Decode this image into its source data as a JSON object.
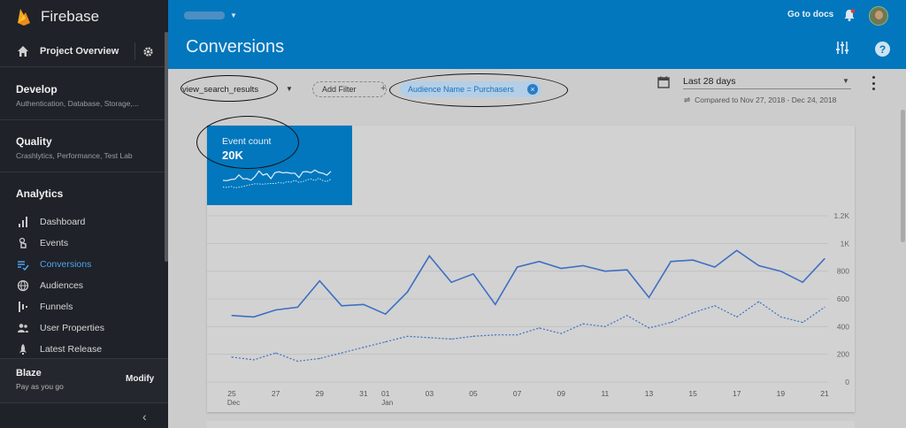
{
  "app": {
    "title": "Firebase"
  },
  "sidebar": {
    "project_overview": "Project Overview",
    "groups": [
      {
        "title": "Develop",
        "subtitle": "Authentication, Database, Storage,..."
      },
      {
        "title": "Quality",
        "subtitle": "Crashlytics, Performance, Test Lab"
      }
    ],
    "analytics_title": "Analytics",
    "items": [
      {
        "label": "Dashboard",
        "icon": "bar-chart-icon",
        "active": false
      },
      {
        "label": "Events",
        "icon": "touch-icon",
        "active": false
      },
      {
        "label": "Conversions",
        "icon": "conversions-icon",
        "active": true
      },
      {
        "label": "Audiences",
        "icon": "globe-icon",
        "active": false
      },
      {
        "label": "Funnels",
        "icon": "funnel-icon",
        "active": false
      },
      {
        "label": "User Properties",
        "icon": "people-icon",
        "active": false
      },
      {
        "label": "Latest Release",
        "icon": "rocket-icon",
        "active": false
      }
    ],
    "plan": {
      "name": "Blaze",
      "subtitle": "Pay as you go",
      "modify": "Modify"
    },
    "collapse_glyph": "‹"
  },
  "header": {
    "docs_link": "Go to docs",
    "page_title": "Conversions"
  },
  "filters": {
    "event": "view_search_results",
    "add_filter": "Add Filter",
    "chip": "Audience Name = Purchasers",
    "date_range": "Last 28 days",
    "compared": "Compared to Nov 27, 2018 - Dec 24, 2018"
  },
  "metric": {
    "title": "Event count",
    "value": "20K"
  },
  "colors": {
    "accent": "#0277bd",
    "active_nav": "#4fa3f0",
    "line": "#3d6fc4"
  },
  "chart_data": {
    "type": "line",
    "x": [
      "25 Dec",
      "26",
      "27",
      "28",
      "29",
      "30",
      "31",
      "01 Jan",
      "02",
      "03",
      "04",
      "05",
      "06",
      "07",
      "08",
      "09",
      "10",
      "11",
      "12",
      "13",
      "14",
      "15",
      "16",
      "17",
      "18",
      "19",
      "20",
      "21"
    ],
    "x_ticks": [
      {
        "label": "25",
        "sub": "Dec",
        "index": 0
      },
      {
        "label": "27",
        "sub": "",
        "index": 2
      },
      {
        "label": "29",
        "sub": "",
        "index": 4
      },
      {
        "label": "31",
        "sub": "",
        "index": 6
      },
      {
        "label": "01",
        "sub": "Jan",
        "index": 7
      },
      {
        "label": "03",
        "sub": "",
        "index": 9
      },
      {
        "label": "05",
        "sub": "",
        "index": 11
      },
      {
        "label": "07",
        "sub": "",
        "index": 13
      },
      {
        "label": "09",
        "sub": "",
        "index": 15
      },
      {
        "label": "11",
        "sub": "",
        "index": 17
      },
      {
        "label": "13",
        "sub": "",
        "index": 19
      },
      {
        "label": "15",
        "sub": "",
        "index": 21
      },
      {
        "label": "17",
        "sub": "",
        "index": 23
      },
      {
        "label": "19",
        "sub": "",
        "index": 25
      },
      {
        "label": "21",
        "sub": "",
        "index": 27
      }
    ],
    "y_ticks": [
      {
        "label": "0",
        "value": 0
      },
      {
        "label": "200",
        "value": 200
      },
      {
        "label": "400",
        "value": 400
      },
      {
        "label": "600",
        "value": 600
      },
      {
        "label": "800",
        "value": 800
      },
      {
        "label": "1K",
        "value": 1000
      },
      {
        "label": "1.2K",
        "value": 1200
      }
    ],
    "ylim": [
      0,
      1200
    ],
    "grid": true,
    "series": [
      {
        "values": [
          480,
          470,
          520,
          540,
          730,
          550,
          560,
          490,
          650,
          910,
          720,
          780,
          560,
          830,
          870,
          820,
          840,
          800,
          810,
          610,
          870,
          880,
          830,
          950,
          840,
          800,
          720,
          890
        ],
        "style": "solid"
      },
      {
        "values": [
          180,
          160,
          210,
          150,
          170,
          210,
          250,
          290,
          330,
          320,
          310,
          330,
          340,
          340,
          390,
          350,
          420,
          400,
          480,
          390,
          430,
          500,
          550,
          470,
          580,
          470,
          430,
          540
        ],
        "style": "dashed"
      }
    ]
  }
}
